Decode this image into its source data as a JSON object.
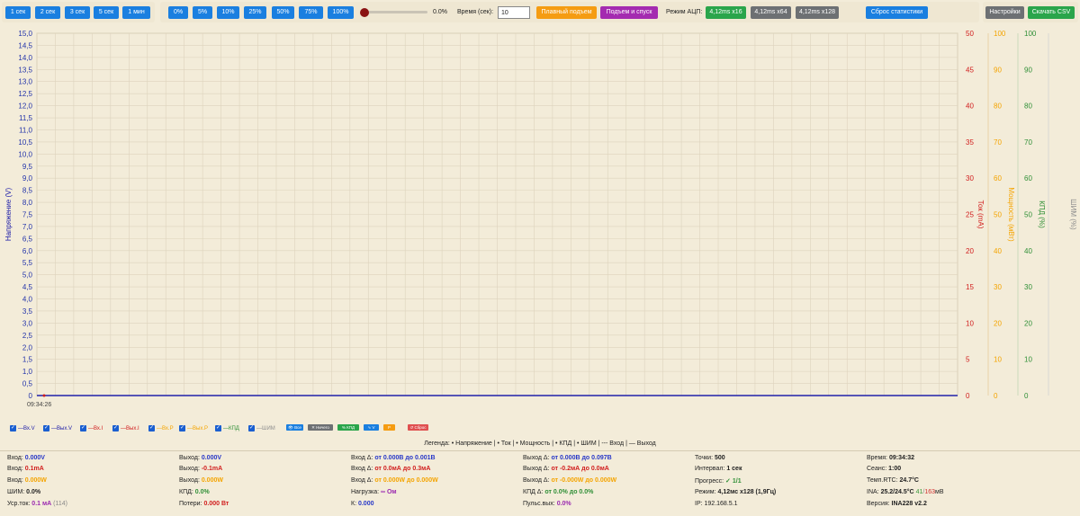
{
  "toolbar": {
    "range_buttons": [
      "1 сек",
      "2 сек",
      "3 сек",
      "5 сек",
      "1 мин"
    ],
    "pwm_buttons": [
      "0%",
      "5%",
      "10%",
      "25%",
      "50%",
      "75%",
      "100%"
    ],
    "pwm_value": "0.0%",
    "time_label": "Время (сек):",
    "time_value": "10",
    "smooth_rise": "Плавный подъем",
    "rise_fall": "Подъем и спуск",
    "adc_label": "Режим АЦП:",
    "adc_modes": [
      "4,12ms x16",
      "4,12ms x64",
      "4,12ms x128"
    ],
    "reset_stats": "Сброс статистики",
    "settings": "Настройки",
    "download_csv": "Скачать CSV"
  },
  "colors": {
    "voltage": "#1a1aa8",
    "current": "#d11d1d",
    "power": "#f4a400",
    "efficiency": "#2f8f36",
    "pwm": "#8e8e8e"
  },
  "chart_data": {
    "type": "line",
    "x": [
      "09:34:26"
    ],
    "y_left": {
      "label": "Напряжение (V)",
      "range": [
        0,
        15
      ],
      "ticks": [
        "0",
        "0,5",
        "1,0",
        "1,5",
        "2,0",
        "2,5",
        "3,0",
        "3,5",
        "4,0",
        "4,5",
        "5,0",
        "5,5",
        "6,0",
        "6,5",
        "7,0",
        "7,5",
        "8,0",
        "8,5",
        "9,0",
        "9,5",
        "10,0",
        "10,5",
        "11,0",
        "11,5",
        "12,0",
        "12,5",
        "13,0",
        "13,5",
        "14,0",
        "14,5",
        "15,0"
      ]
    },
    "y_current": {
      "label": "Ток (mA)",
      "range": [
        0,
        50
      ],
      "ticks": [
        "0",
        "5",
        "10",
        "15",
        "20",
        "25",
        "30",
        "35",
        "40",
        "45",
        "50"
      ]
    },
    "y_power": {
      "label": "Мощность (мВт)",
      "range": [
        0,
        100
      ],
      "ticks": [
        "0",
        "10",
        "20",
        "30",
        "40",
        "50",
        "60",
        "70",
        "80",
        "90",
        "100"
      ]
    },
    "y_efficiency": {
      "label": "КПД (%)",
      "range": [
        0,
        100
      ],
      "ticks": [
        "0",
        "10",
        "20",
        "30",
        "40",
        "50",
        "60",
        "70",
        "80",
        "90",
        "100"
      ]
    },
    "y_pwm": {
      "label": "ШИМ (%)",
      "range": [
        0,
        100
      ]
    },
    "series": [
      {
        "name": "Вх.V",
        "values": [
          0
        ]
      },
      {
        "name": "Вых.V",
        "values": [
          0
        ]
      }
    ],
    "grid": true
  },
  "legend_toggles": [
    {
      "label": "—Вх.V",
      "checked": true,
      "color": "#1a1aa8"
    },
    {
      "label": "—Вых.V",
      "checked": true,
      "color": "#1a1aa8"
    },
    {
      "label": "—Вх.I",
      "checked": true,
      "color": "#d11d1d"
    },
    {
      "label": "—Вых.I",
      "checked": true,
      "color": "#d11d1d"
    },
    {
      "label": "—Вх.P",
      "checked": true,
      "color": "#f4a400"
    },
    {
      "label": "—Вых.P",
      "checked": true,
      "color": "#f4a400"
    },
    {
      "label": "—КПД",
      "checked": true,
      "color": "#2f8f36"
    },
    {
      "label": "—ШИМ",
      "checked": true,
      "color": "#8e8e8e"
    }
  ],
  "legend_buttons": [
    "Все",
    "Ничего",
    "КПД",
    "V",
    "P",
    "Сброс"
  ],
  "legend_text": "Легенда: • Напряжение | • Ток | • Мощность | • КПД | • ШИМ | --- Вход | — Выход",
  "stats": {
    "col1": [
      {
        "label": "Вход:",
        "value": "0.000V",
        "cls": "c-blue"
      },
      {
        "label": "Вход:",
        "value": "0.1mA",
        "cls": "c-red"
      },
      {
        "label": "Вход:",
        "value": "0.000W",
        "cls": "c-orange"
      },
      {
        "label": "ШИМ:",
        "value": "0.0%",
        "cls": "c-bold"
      },
      {
        "label": "Уср.ток:",
        "value": "0.1 мА",
        "cls": "c-purple",
        "extra": "(114)"
      }
    ],
    "col2": [
      {
        "label": "Выход:",
        "value": "0.000V",
        "cls": "c-blue"
      },
      {
        "label": "Выход:",
        "value": "-0.1mA",
        "cls": "c-red"
      },
      {
        "label": "Выход:",
        "value": "0.000W",
        "cls": "c-orange"
      },
      {
        "label": "КПД:",
        "value": "0.0%",
        "cls": "c-green"
      },
      {
        "label": "Потери:",
        "value": "0.000 Вт",
        "cls": "c-red"
      }
    ],
    "col3": [
      {
        "label": "Вход Δ:",
        "value": "от 0.000В до 0.001В",
        "cls": "c-blue"
      },
      {
        "label": "Вход Δ:",
        "value": "от 0.0мА до 0.3мА",
        "cls": "c-red"
      },
      {
        "label": "Вход Δ:",
        "value": "от 0.000W до 0.000W",
        "cls": "c-orange"
      },
      {
        "label": "Нагрузка:",
        "value": "∞ Ом",
        "cls": "c-purple"
      },
      {
        "label": "К:",
        "value": "0.000",
        "cls": "c-blue"
      }
    ],
    "col4": [
      {
        "label": "Выход Δ:",
        "value": "от 0.000В до 0.097В",
        "cls": "c-blue"
      },
      {
        "label": "Выход Δ:",
        "value": "от -0.2мА до 0.0мА",
        "cls": "c-red"
      },
      {
        "label": "Выход Δ:",
        "value": "от -0.000W до 0.000W",
        "cls": "c-orange"
      },
      {
        "label": "КПД Δ:",
        "value": "от 0.0% до 0.0%",
        "cls": "c-green"
      },
      {
        "label": "Пульс.вых:",
        "value": "0.0%",
        "cls": "c-purple"
      }
    ],
    "col5": [
      {
        "label": "Точки:",
        "value": "500",
        "cls": "c-bold"
      },
      {
        "label": "Интервал:",
        "value": "1 сек",
        "cls": "c-bold"
      },
      {
        "label": "Прогресс:",
        "value": "✓ 1/1",
        "cls": "c-green"
      },
      {
        "label": "Режим:",
        "value": "4,12мс x128 (1,9Гц)",
        "cls": "c-bold"
      },
      {
        "label": "IP:",
        "value": "192.168.5.1",
        "cls": ""
      }
    ],
    "col6": [
      {
        "label": "Время:",
        "value": "09:34:32",
        "cls": "c-bold"
      },
      {
        "label": "Сеанс:",
        "value": "1:00",
        "cls": "c-bold"
      },
      {
        "label": "Темп.RTC:",
        "value": "24.7°C",
        "cls": "c-bold"
      },
      {
        "label": "INA:",
        "value": "25.2/24.5°C",
        "cls": "c-bold",
        "extra_green": "41",
        "extra_red": "163",
        "extra_unit": "мВ"
      },
      {
        "label": "Версия:",
        "value": "INA228 v2.2",
        "cls": "c-bold"
      }
    ]
  }
}
